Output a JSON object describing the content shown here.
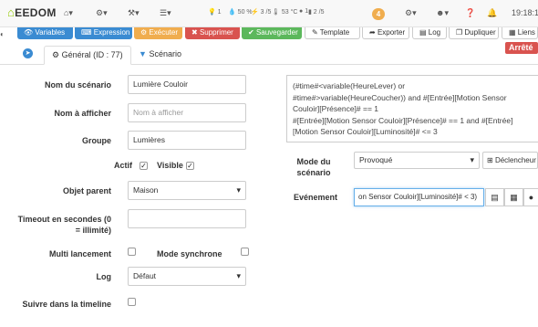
{
  "navbar": {
    "logo_text": "EEDOM",
    "home_icon": "home-icon",
    "stats": {
      "lights": "1",
      "humidity": "50 %",
      "power": "3 /5",
      "temperature": "53 °C",
      "users": "1",
      "doors": "2 /5"
    },
    "notification_count": "4",
    "clock": "19:18:1"
  },
  "actions": {
    "variables": "Variables",
    "expression": "Expression",
    "execute": "Exécuter",
    "delete": "Supprimer",
    "save": "Sauvegarder",
    "template": "Template",
    "export": "Exporter",
    "log": "Log",
    "duplicate": "Dupliquer",
    "links": "Liens"
  },
  "tabs": {
    "general": "Général (ID : 77)",
    "scenario": "Scénario"
  },
  "status": "Arrêté",
  "form": {
    "name_label": "Nom du scénario",
    "name_value": "Lumière Couloir",
    "display_label": "Nom à afficher",
    "display_placeholder": "Nom à afficher",
    "group_label": "Groupe",
    "group_value": "Lumières",
    "active_label": "Actif",
    "visible_label": "Visible",
    "parent_label": "Objet parent",
    "parent_value": "Maison",
    "timeout_label_1": "Timeout en secondes (0",
    "timeout_label_2": "= illimité)",
    "timeout_value": "",
    "multi_label": "Multi lancement",
    "sync_label": "Mode synchrone",
    "log_label": "Log",
    "log_value": "Défaut",
    "timeline_label": "Suivre dans la timeline"
  },
  "condition": {
    "lines": [
      "(#time#<variable(HeureLever) or",
      "#time#>variable(HeureCoucher)) and #[Entrée][Motion Sensor",
      "Couloir][Présence]# == 1",
      "#[Entrée][Motion Sensor Couloir][Présence]# == 1 and #[Entrée]",
      "[Motion Sensor Couloir][Luminosité]# <= 3"
    ]
  },
  "mode": {
    "label_1": "Mode du",
    "label_2": "scénario",
    "value": "Provoqué",
    "trigger_button": "Déclencheur"
  },
  "event": {
    "label": "Evénement",
    "value": "on Sensor Couloir][Luminosité]# < 3)"
  },
  "checkboxes": {
    "active": true,
    "visible": true,
    "multi": false,
    "sync": false,
    "timeline": false
  }
}
